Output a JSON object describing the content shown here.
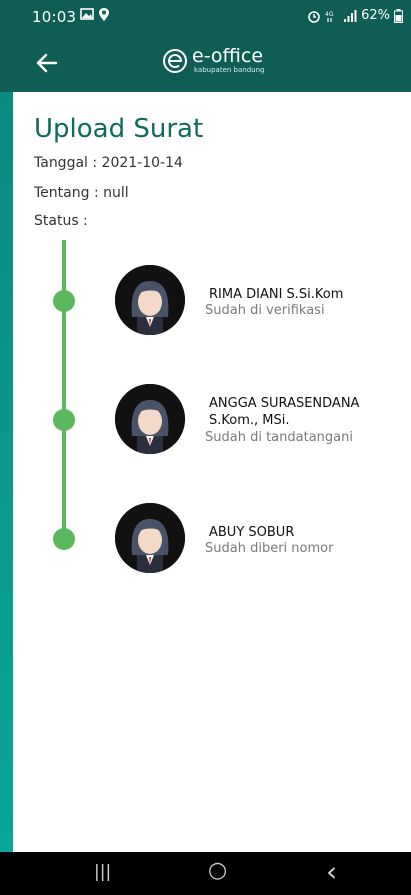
{
  "status_bar": {
    "time": "10:03",
    "battery": "62%",
    "icons": [
      "gallery-icon",
      "location-icon",
      "alarm-icon",
      "network-icon",
      "signal-icon",
      "battery-icon"
    ]
  },
  "app_bar": {
    "logo_name": "e-office",
    "logo_sub": "kabupaten bandung"
  },
  "page": {
    "title": "Upload Surat",
    "tanggal": "Tanggal : 2021-10-14",
    "tentang": "Tentang : null",
    "status_label": "Status :"
  },
  "timeline": [
    {
      "name": "RIMA DIANI S.Si.Kom",
      "status": "Sudah di verifikasi"
    },
    {
      "name": "ANGGA SURASENDANA S.Kom., MSi.",
      "status": "Sudah di tandatangani"
    },
    {
      "name": "ABUY SOBUR",
      "status": "Sudah diberi nomor"
    }
  ],
  "nav": {
    "recent": "|||",
    "home": "○",
    "back": "‹"
  },
  "colors": {
    "primary": "#0f5e55",
    "title": "#0f6a60",
    "timeline": "#5cb85c"
  }
}
